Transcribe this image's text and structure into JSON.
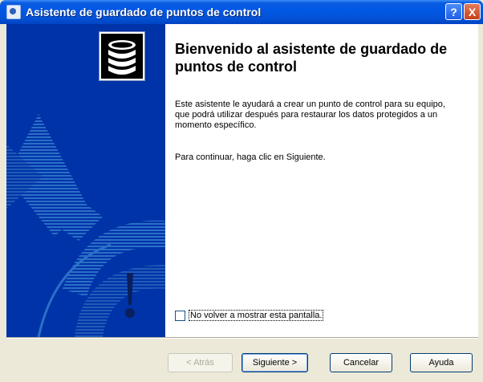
{
  "window": {
    "title": "Asistente de guardado de puntos de control",
    "help_glyph": "?",
    "close_glyph": "X"
  },
  "content": {
    "heading": "Bienvenido al asistente de guardado de puntos de control",
    "paragraph1": "Este asistente le ayudará a crear un punto de control para su equipo, que podrá utilizar después para restaurar los datos protegidos a un momento específico.",
    "paragraph2": "Para continuar, haga clic en Siguiente.",
    "checkbox_label": "No volver a mostrar esta pantalla.",
    "checkbox_checked": false
  },
  "buttons": {
    "back": "< Atrás",
    "next": "Siguiente >",
    "cancel": "Cancelar",
    "help": "Ayuda"
  },
  "icons": {
    "title": "wizard-icon",
    "logo": "database-stack-icon"
  },
  "colors": {
    "titlebar": "#0058e6",
    "sidebar": "#0033a8",
    "dialog_bg": "#ece9d8"
  }
}
